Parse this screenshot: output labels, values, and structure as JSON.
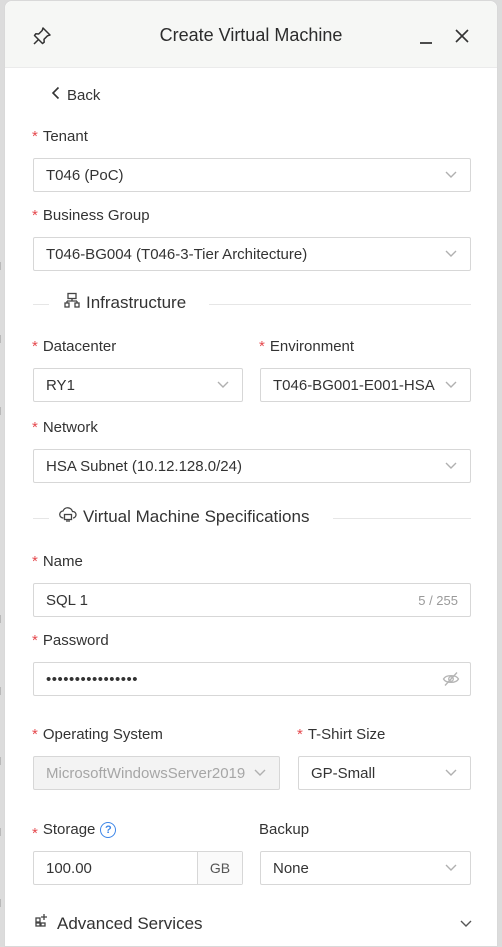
{
  "dialog": {
    "title": "Create Virtual Machine"
  },
  "nav": {
    "back_label": "Back"
  },
  "form": {
    "tenant": {
      "label": "Tenant",
      "value": "T046 (PoC)"
    },
    "business_group": {
      "label": "Business Group",
      "value": "T046-BG004 (T046-3-Tier Architecture)"
    },
    "infrastructure_section": "Infrastructure",
    "datacenter": {
      "label": "Datacenter",
      "value": "RY1"
    },
    "environment": {
      "label": "Environment",
      "value": "T046-BG001-E001-HSA"
    },
    "network": {
      "label": "Network",
      "value": "HSA Subnet (10.12.128.0/24)"
    },
    "vm_spec_section": "Virtual Machine Specifications",
    "name": {
      "label": "Name",
      "value": "SQL 1",
      "counter": "5 / 255"
    },
    "password": {
      "label": "Password",
      "value": "••••••••••••••••"
    },
    "os": {
      "label": "Operating System",
      "value": "MicrosoftWindowsServer2019"
    },
    "tshirt": {
      "label": "T-Shirt Size",
      "value": "GP-Small"
    },
    "storage": {
      "label": "Storage",
      "value": "100.00",
      "unit": "GB"
    },
    "backup": {
      "label": "Backup",
      "value": "None"
    },
    "advanced_section": "Advanced Services"
  },
  "required_marker": "*",
  "colors": {
    "required": "#e5484d",
    "help": "#3d86e8",
    "header_bg": "#f6f7f5"
  }
}
